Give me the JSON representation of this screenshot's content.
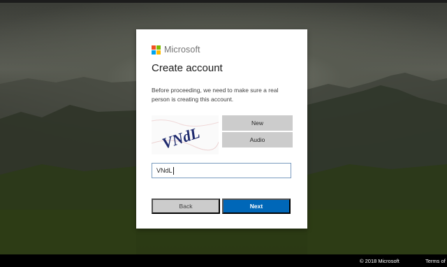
{
  "brand": {
    "name": "Microsoft",
    "logo_colors": [
      "#f25022",
      "#7fba00",
      "#00a4ef",
      "#ffb900"
    ]
  },
  "dialog": {
    "title": "Create account",
    "description": "Before proceeding, we need to make sure a real person is creating this account.",
    "captcha_text": "VNdL",
    "new_label": "New",
    "audio_label": "Audio",
    "input_value": "VNdL",
    "back_label": "Back",
    "next_label": "Next"
  },
  "footer": {
    "copyright": "© 2018 Microsoft",
    "terms": "Terms of"
  },
  "colors": {
    "accent": "#0067b8",
    "button_gray": "#cccccc"
  }
}
